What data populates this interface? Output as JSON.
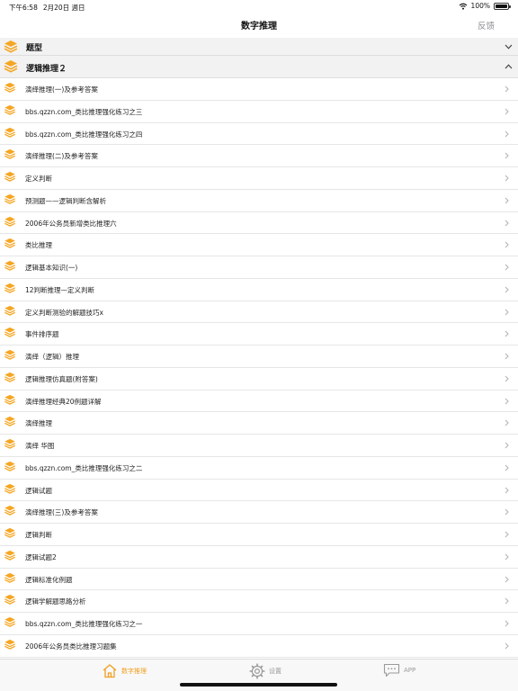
{
  "status_bar": {
    "time": "下午6:58",
    "date": "2月20日 週日",
    "battery": "100%"
  },
  "nav": {
    "title": "数字推理",
    "feedback": "反馈"
  },
  "sections": {
    "category": "题型",
    "current": "逻辑推理２"
  },
  "items": [
    {
      "label": "演绎推理(一)及参考答案"
    },
    {
      "label": "bbs.qzzn.com_类比推理强化练习之三"
    },
    {
      "label": "bbs.qzzn.com_类比推理强化练习之四"
    },
    {
      "label": "演绎推理(二)及参考答案"
    },
    {
      "label": "定义判断"
    },
    {
      "label": "预测题——逻辑判断含解析"
    },
    {
      "label": "2006年公务员新增类比推理六"
    },
    {
      "label": "类比推理"
    },
    {
      "label": "逻辑基本知识(一)"
    },
    {
      "label": "12判断推理—定义判断"
    },
    {
      "label": "定义判断测验的解题技巧x"
    },
    {
      "label": "事件排序题"
    },
    {
      "label": "演绎（逻辑）推理"
    },
    {
      "label": "逻辑推理仿真题(附答案)"
    },
    {
      "label": "演绎推理经典20例题详解"
    },
    {
      "label": "演绎推理"
    },
    {
      "label": "演绎  华图"
    },
    {
      "label": "bbs.qzzn.com_类比推理强化练习之二"
    },
    {
      "label": "逻辑试题"
    },
    {
      "label": "演绎推理(三)及参考答案"
    },
    {
      "label": "逻辑判断"
    },
    {
      "label": "逻辑试题2"
    },
    {
      "label": "逻辑标准化例题"
    },
    {
      "label": "逻辑学解题思路分析"
    },
    {
      "label": "bbs.qzzn.com_类比推理强化练习之一"
    },
    {
      "label": "2006年公务员类比推理习题集"
    }
  ],
  "tabs": [
    {
      "label": "数字推理",
      "icon": "home-icon",
      "active": true
    },
    {
      "label": "设置",
      "icon": "gear-icon",
      "active": false
    },
    {
      "label": "APP",
      "icon": "chat-bubble-icon",
      "active": false
    }
  ],
  "colors": {
    "accent": "#f0a020",
    "icon_orange": "#f5a623",
    "section_bg": "#f2f2f2",
    "tab_inactive": "#9a9a9a"
  }
}
